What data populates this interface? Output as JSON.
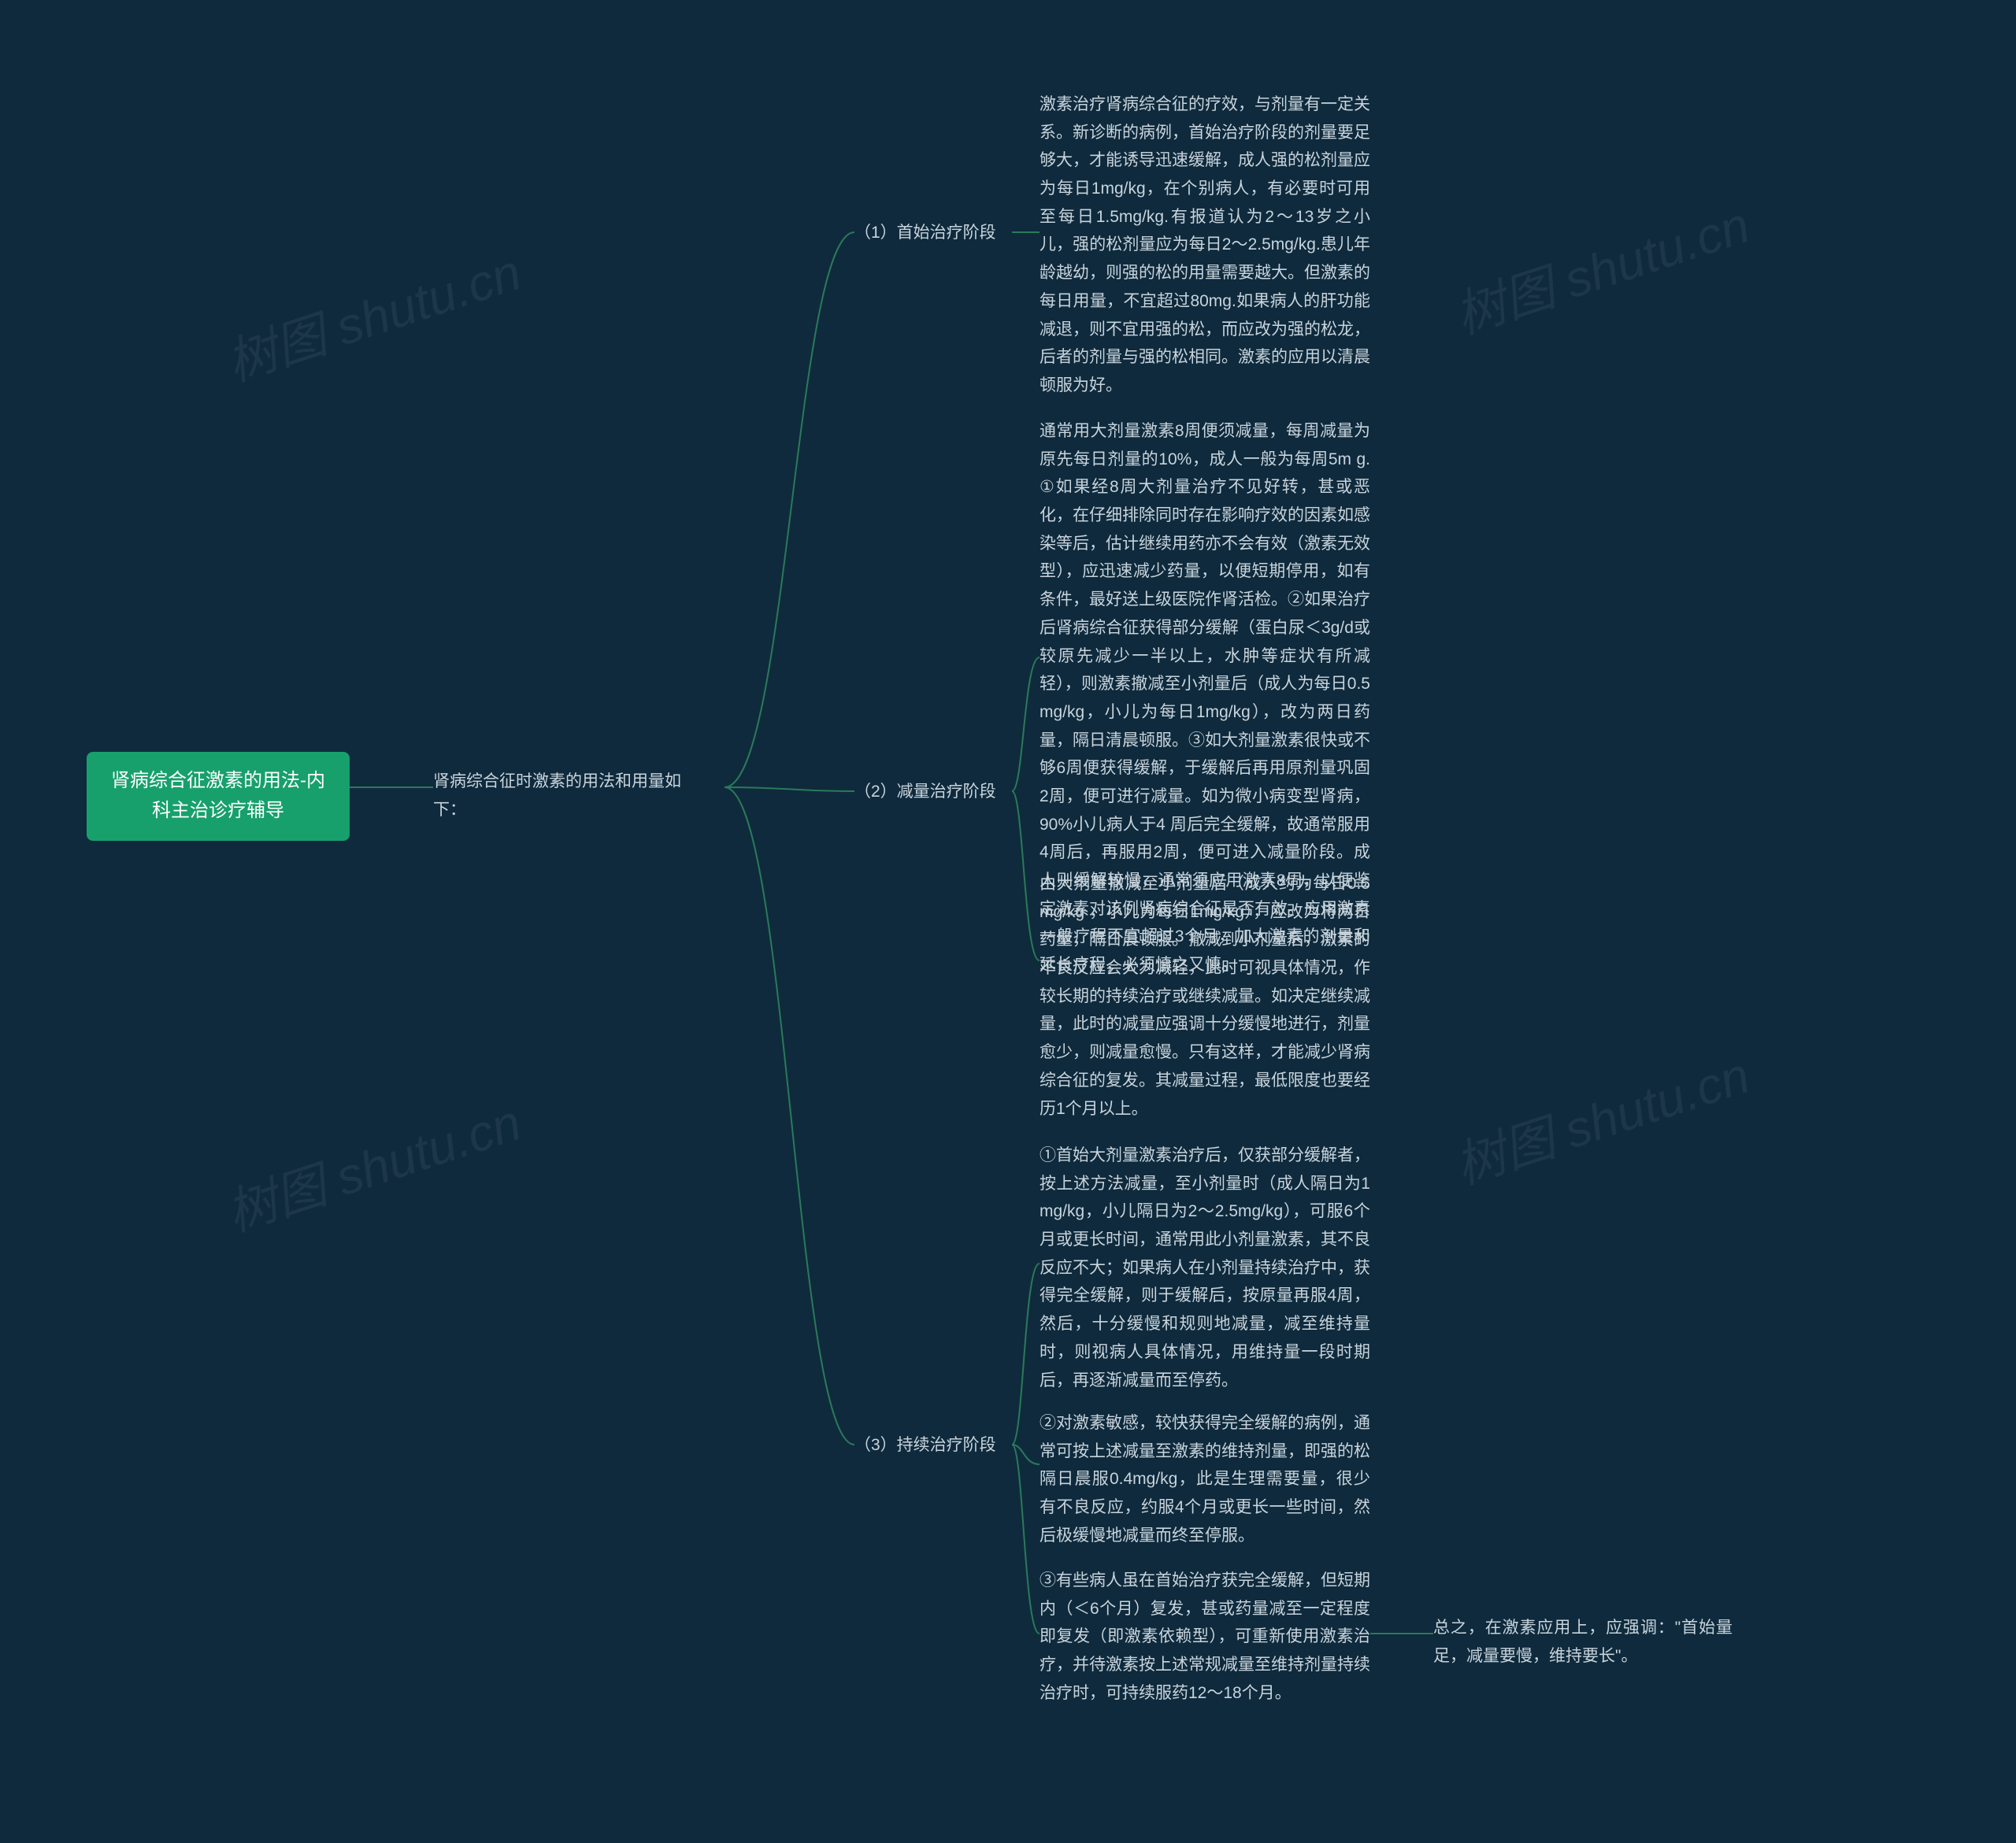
{
  "watermark": {
    "line1": "树图 shutu.cn"
  },
  "root": {
    "title_line1": "肾病综合征激素的用法-内",
    "title_line2": "科主治诊疗辅导"
  },
  "level1": {
    "label": "肾病综合征时激素的用法和用量如\n下："
  },
  "stages": [
    {
      "label": "（1）首始治疗阶段"
    },
    {
      "label": "（2）减量治疗阶段"
    },
    {
      "label": "（3）持续治疗阶段"
    }
  ],
  "content": {
    "stage1_p1": "激素治疗肾病综合征的疗效，与剂量有一定关系。新诊断的病例，首始治疗阶段的剂量要足够大，才能诱导迅速缓解，成人强的松剂量应为每日1mg/kg，在个别病人，有必要时可用至每日1.5mg/kg.有报道认为2～13岁之小儿，强的松剂量应为每日2～2.5mg/kg.患儿年龄越幼，则强的松的用量需要越大。但激素的每日用量，不宜超过80mg.如果病人的肝功能减退，则不宜用强的松，而应改为强的松龙，后者的剂量与强的松相同。激素的应用以清晨顿服为好。",
    "stage2_p1": "通常用大剂量激素8周便须减量，每周减量为原先每日剂量的10%，成人一般为每周5m g.①如果经8周大剂量治疗不见好转，甚或恶化，在仔细排除同时存在影响疗效的因素如感染等后，估计继续用药亦不会有效（激素无效型），应迅速减少药量，以便短期停用，如有条件，最好送上级医院作肾活检。②如果治疗后肾病综合征获得部分缓解（蛋白尿＜3g/d或较原先减少一半以上，水肿等症状有所减轻），则激素撤减至小剂量后（成人为每日0.5mg/kg，小儿为每日1mg/kg），改为两日药量，隔日清晨顿服。③如大剂量激素很快或不够6周便获得缓解，于缓解后再用原剂量巩固2周，便可进行减量。如为微小病变型肾病，90%小儿病人于4 周后完全缓解，故通常服用4周后，再服用2周，便可进入减量阶段。成人则缓解较慢，通常须应用激素8周，以便鉴定激素对该例肾病综合征是否有效。应用激素一般疗程不宜超过3个月，加大激素的剂量和延长疗程，必须慎之又慎。",
    "stage2_p2": "由大剂量撤减至小剂量后（成人约为每日0.5mg/kg ，小儿为每日1mg/kg），应改为将两日药量，隔日晨顿服。撤减到小剂量后，激素的不良反应会大为减轻，此时可视具体情况，作较长期的持续治疗或继续减量。如决定继续减量，此时的减量应强调十分缓慢地进行，剂量愈少，则减量愈慢。只有这样，才能减少肾病综合征的复发。其减量过程，最低限度也要经历1个月以上。",
    "stage3_p1": "①首始大剂量激素治疗后，仅获部分缓解者，按上述方法减量，至小剂量时（成人隔日为1mg/kg，小儿隔日为2～2.5mg/kg），可服6个月或更长时间，通常用此小剂量激素，其不良反应不大；如果病人在小剂量持续治疗中，获得完全缓解，则于缓解后，按原量再服4周，然后，十分缓慢和规则地减量，减至维持量时，则视病人具体情况，用维持量一段时期后，再逐渐减量而至停药。",
    "stage3_p2": "②对激素敏感，较快获得完全缓解的病例，通常可按上述减量至激素的维持剂量，即强的松隔日晨服0.4mg/kg，此是生理需要量，很少有不良反应，约服4个月或更长一些时间，然后极缓慢地减量而终至停服。",
    "stage3_p3": "③有些病人虽在首始治疗获完全缓解，但短期内（＜6个月）复发，甚或药量减至一定程度即复发（即激素依赖型），可重新使用激素治疗，并待激素按上述常规减量至维持剂量持续治疗时，可持续服药12～18个月。"
  },
  "final": {
    "text": "总之，在激素应用上，应强调：\"首始量足，减量要慢，维持要长\"。"
  }
}
